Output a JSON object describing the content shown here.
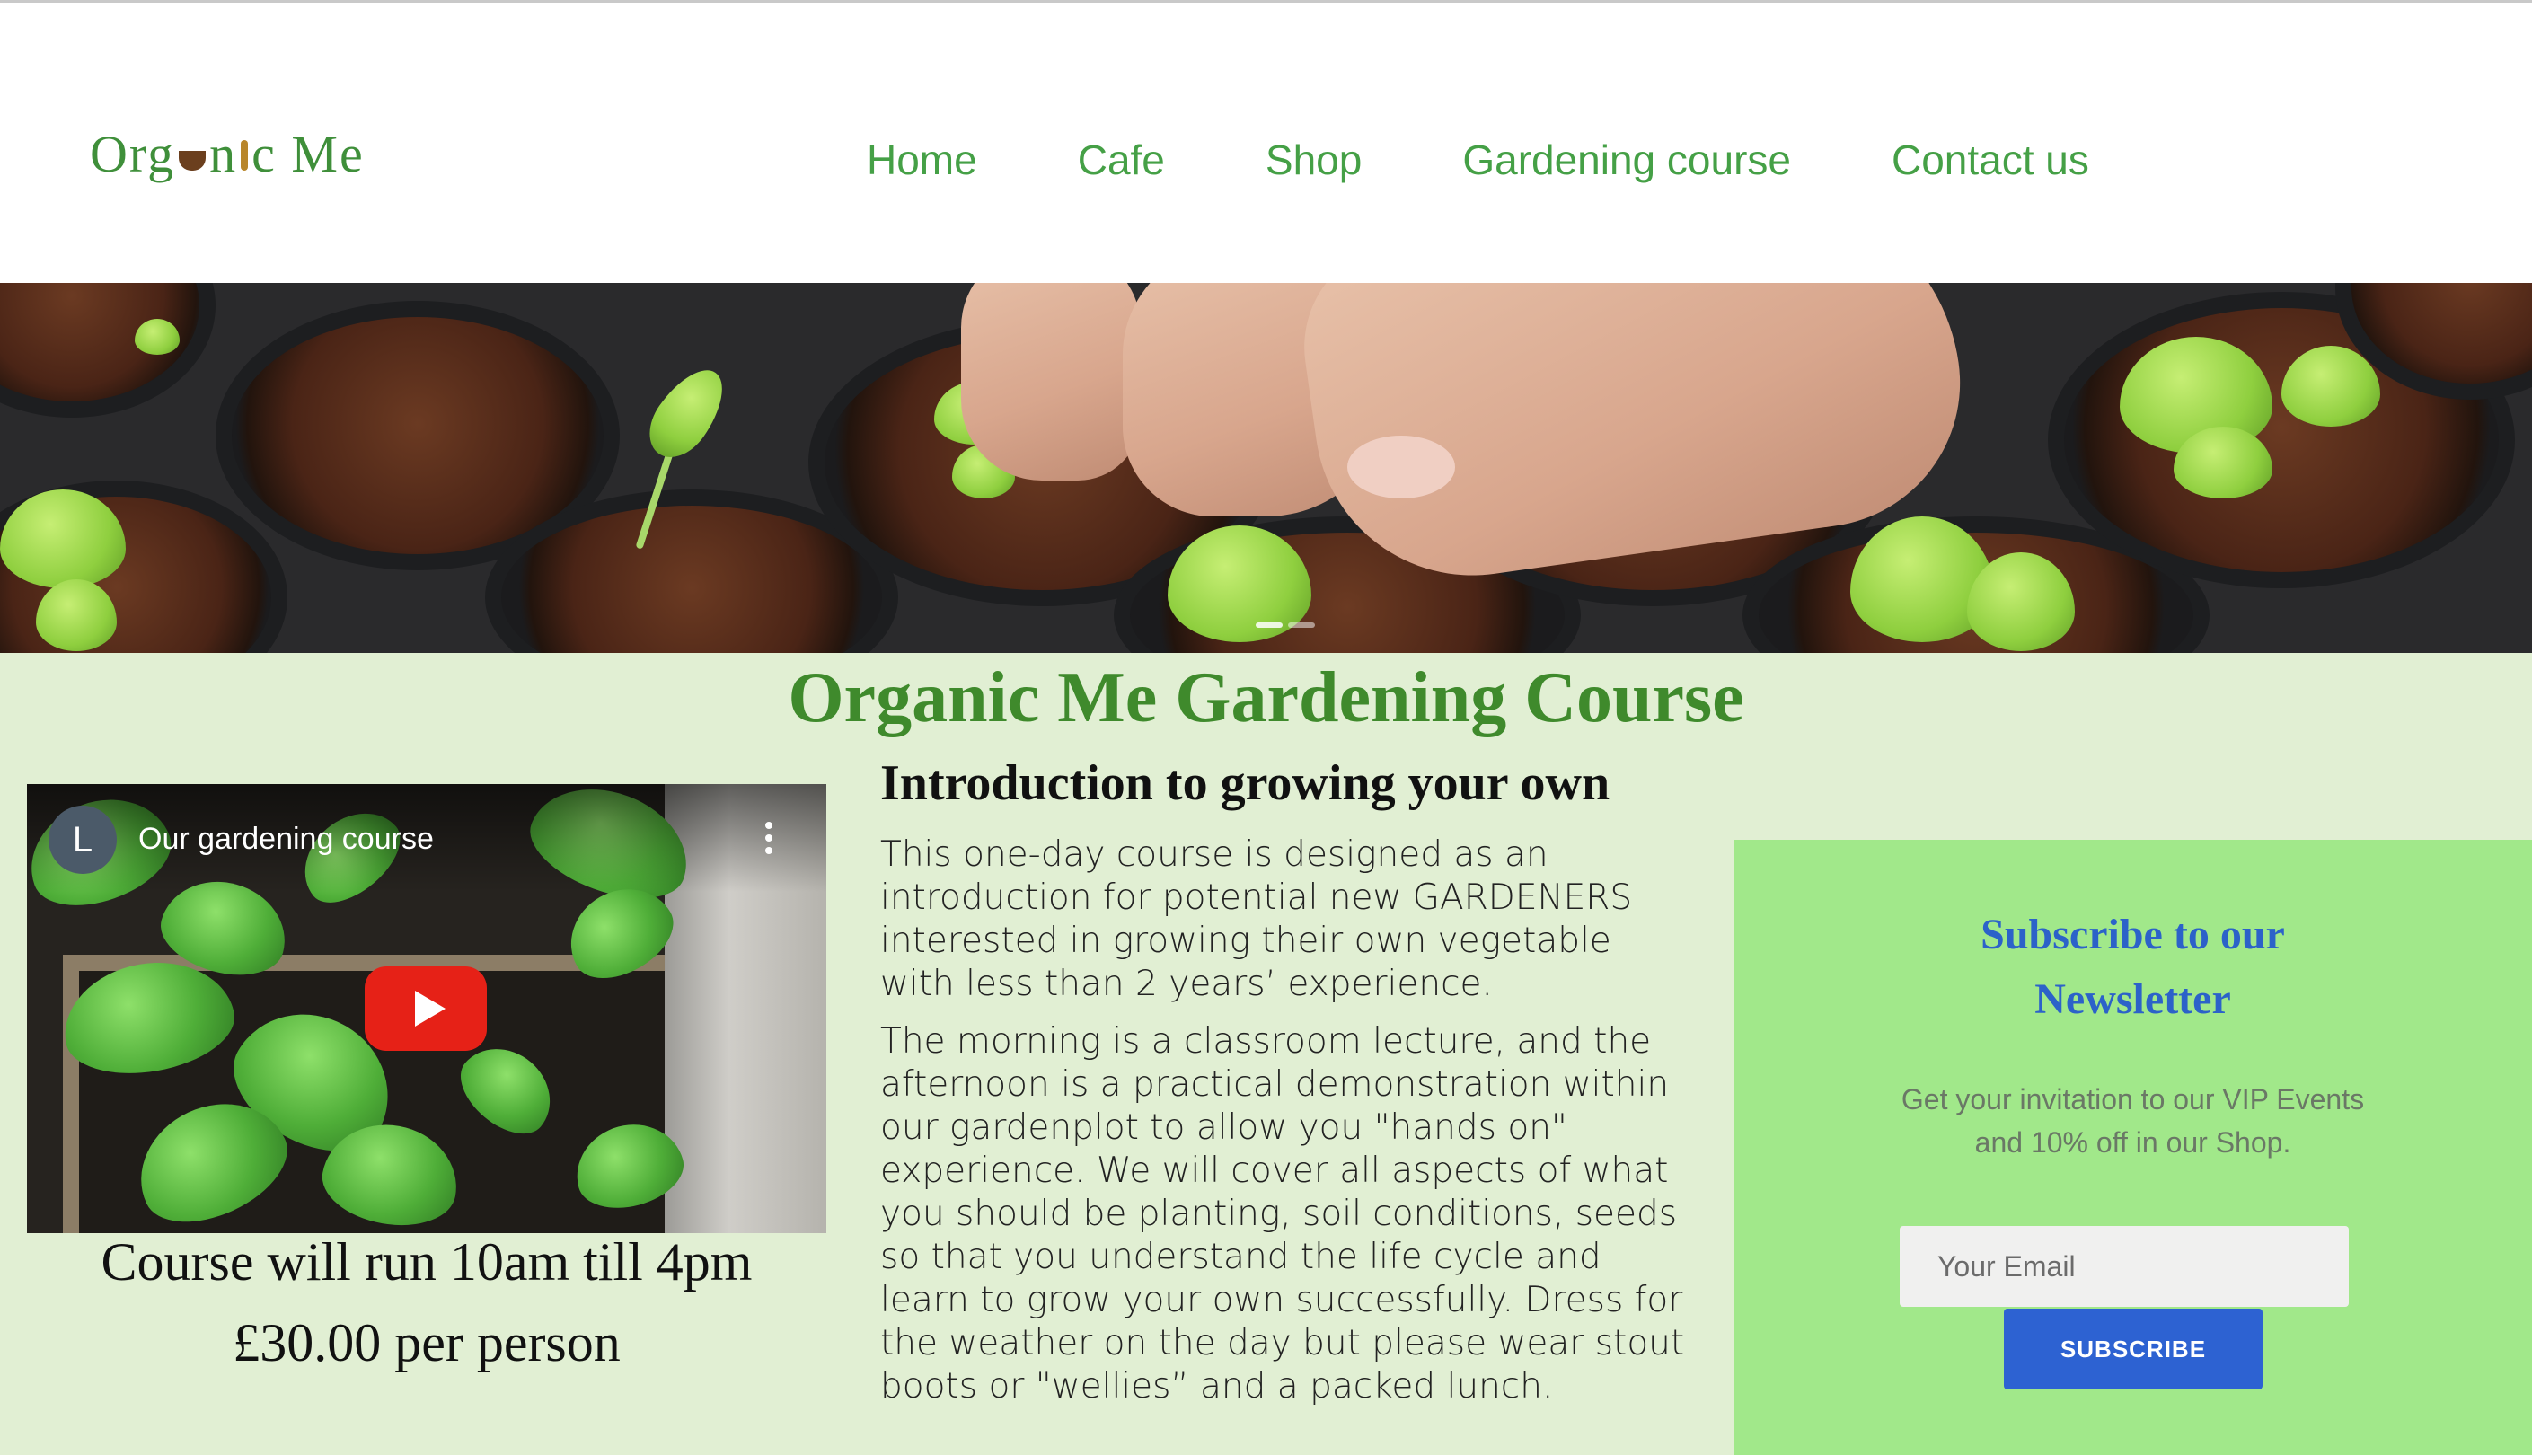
{
  "brand": {
    "logo_text": "Organic Me"
  },
  "nav": {
    "items": [
      {
        "label": "Home"
      },
      {
        "label": "Cafe"
      },
      {
        "label": "Shop"
      },
      {
        "label": "Gardening course"
      },
      {
        "label": "Contact us"
      }
    ]
  },
  "hero": {
    "image": "hand-planting-seedlings-photo"
  },
  "page": {
    "title": "Organic Me Gardening Course"
  },
  "video": {
    "channel_initial": "L",
    "title": "Our gardening course",
    "play_icon": "play-icon",
    "menu_icon": "more-vertical-icon"
  },
  "course": {
    "time": "Course will run 10am till 4pm",
    "price": "£30.00 per person"
  },
  "intro": {
    "heading": "Introduction to growing your own",
    "paragraph1": "This one-day course is designed as an introduction for potential new GARDENERS interested in growing their own vegetable with less than 2 years’ experience.",
    "paragraph2": "The morning is a classroom lecture, and the afternoon is a practical demonstration within our gardenplot to allow you \"hands on\" experience. We will cover all aspects of what you should be planting, soil conditions, seeds so that you understand the life cycle and learn to grow your own successfully. Dress for the weather on the day but please wear stout boots or \"wellies” and a packed lunch."
  },
  "newsletter": {
    "title": "Subscribe to our Newsletter",
    "text": "Get your invitation to our VIP Events and 10% off in our Shop.",
    "email_placeholder": "Your Email",
    "button_label": "SUBSCRIBE"
  },
  "colors": {
    "nav_green": "#45a046",
    "title_green": "#3f8a2c",
    "page_background": "#e1efd3",
    "newsletter_background": "#a1e88a",
    "newsletter_title": "#2c62c9",
    "button_blue": "#2d62d2"
  }
}
